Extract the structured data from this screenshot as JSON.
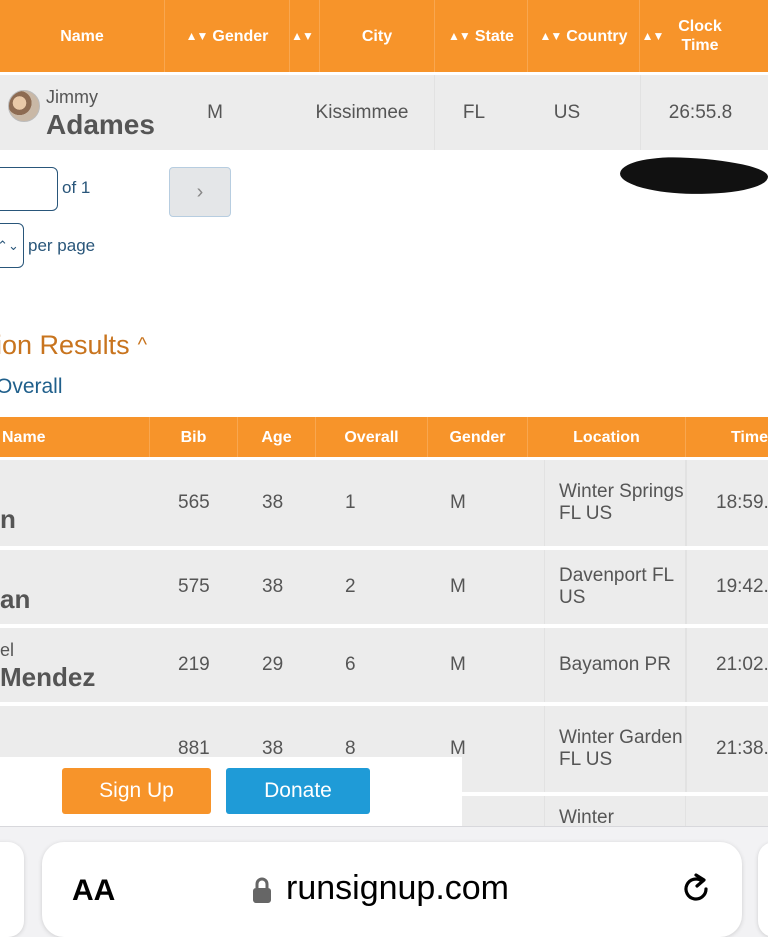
{
  "top_table": {
    "headers": [
      {
        "label": "Name",
        "sortable": false
      },
      {
        "label": "Gender",
        "sortable": true
      },
      {
        "label": "",
        "sortable": true
      },
      {
        "label": "City",
        "sortable": false
      },
      {
        "label": "State",
        "sortable": true
      },
      {
        "label": "Country",
        "sortable": true
      },
      {
        "label": "",
        "sortable": true
      },
      {
        "label": "Clock\nTime",
        "sortable": false
      }
    ],
    "sort_glyph": "▲▼",
    "row": {
      "first_name": "Jimmy",
      "last_name": "Adames",
      "gender": "M",
      "city": "Kissimmee",
      "state": "FL",
      "country": "US",
      "clock_time": "26:55.8"
    }
  },
  "pagination": {
    "page_input_value": "",
    "of_label": "of 1",
    "next_glyph": "›",
    "per_page_glyph": "⌃⌄",
    "per_page_label": "per page"
  },
  "section": {
    "title": "ion Results",
    "chevron": "^",
    "overall_link": "Overall"
  },
  "results_table": {
    "headers": [
      "Name",
      "Bib",
      "Age",
      "Overall",
      "Gender",
      "Location",
      "Time"
    ],
    "rows": [
      {
        "first": "",
        "last": "n",
        "bib": "565",
        "age": "38",
        "overall": "1",
        "gender": "M",
        "location": "Winter Springs FL US",
        "time": "18:59."
      },
      {
        "first": "",
        "last": "an",
        "bib": "575",
        "age": "38",
        "overall": "2",
        "gender": "M",
        "location": "Davenport FL US",
        "time": "19:42."
      },
      {
        "first": "el",
        "last": "Mendez",
        "bib": "219",
        "age": "29",
        "overall": "6",
        "gender": "M",
        "location": "Bayamon PR",
        "time": "21:02."
      },
      {
        "first": "",
        "last": "",
        "bib": "881",
        "age": "38",
        "overall": "8",
        "gender": "M",
        "location": "Winter Garden FL US",
        "time": "21:38."
      },
      {
        "location": "Winter"
      }
    ]
  },
  "actions": {
    "signup_label": "Sign Up",
    "donate_label": "Donate"
  },
  "browser": {
    "text_size_label": "AA",
    "url": "runsignup.com"
  },
  "colors": {
    "header_orange": "#f7942a",
    "row_grey": "#ececec",
    "link_blue": "#1f5f8b",
    "section_orange": "#c8741e",
    "donate_blue": "#1f9bd7"
  }
}
